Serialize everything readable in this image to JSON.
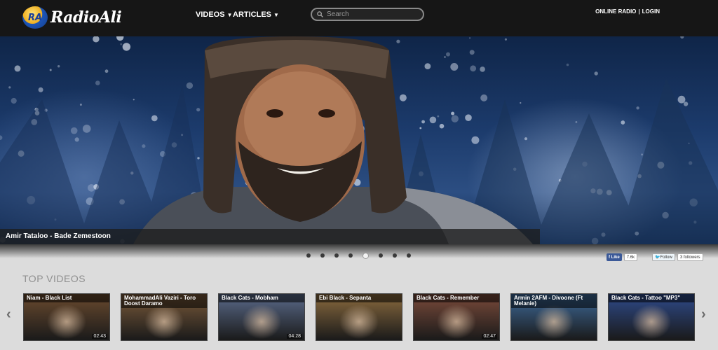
{
  "header": {
    "logo_badge": "RA",
    "logo_text": "RadioAli",
    "nav": [
      {
        "label": "VIDEOS"
      },
      {
        "label": "ARTICLES"
      }
    ],
    "search_placeholder": "Search",
    "online_radio": "ONLINE RADIO",
    "separator": "|",
    "login": "LOGIN"
  },
  "hero": {
    "caption": "Amir Tataloo - Bade Zemestoon",
    "slide_count": 8,
    "active_slide": 5
  },
  "social": {
    "fb_label": "Like",
    "fb_count": "7.6k",
    "tw_label": "Follow",
    "tw_count": "3 followers"
  },
  "top_videos": {
    "title": "TOP VIDEOS",
    "prev_icon": "chevron-left-icon",
    "next_icon": "chevron-right-icon",
    "items": [
      {
        "title": "Niam - Black List",
        "duration": "02:43",
        "color": "#6a4a2e"
      },
      {
        "title": "MohammadAli Vaziri - Toro Doost Daramo",
        "duration": "",
        "color": "#7a5a3a"
      },
      {
        "title": "Black Cats - Mobham",
        "duration": "04:28",
        "color": "#5a6a8a"
      },
      {
        "title": "Ebi Black - Sepanta",
        "duration": "",
        "color": "#8a6a3e"
      },
      {
        "title": "Black Cats - Remember",
        "duration": "02:47",
        "color": "#7a4a3a"
      },
      {
        "title": "Armin 2AFM - Divoone (Ft Melanie)",
        "duration": "",
        "color": "#3e6a9a"
      },
      {
        "title": "Black Cats - Tattoo \"MP3\"",
        "duration": "",
        "color": "#2e4a8a"
      }
    ]
  }
}
